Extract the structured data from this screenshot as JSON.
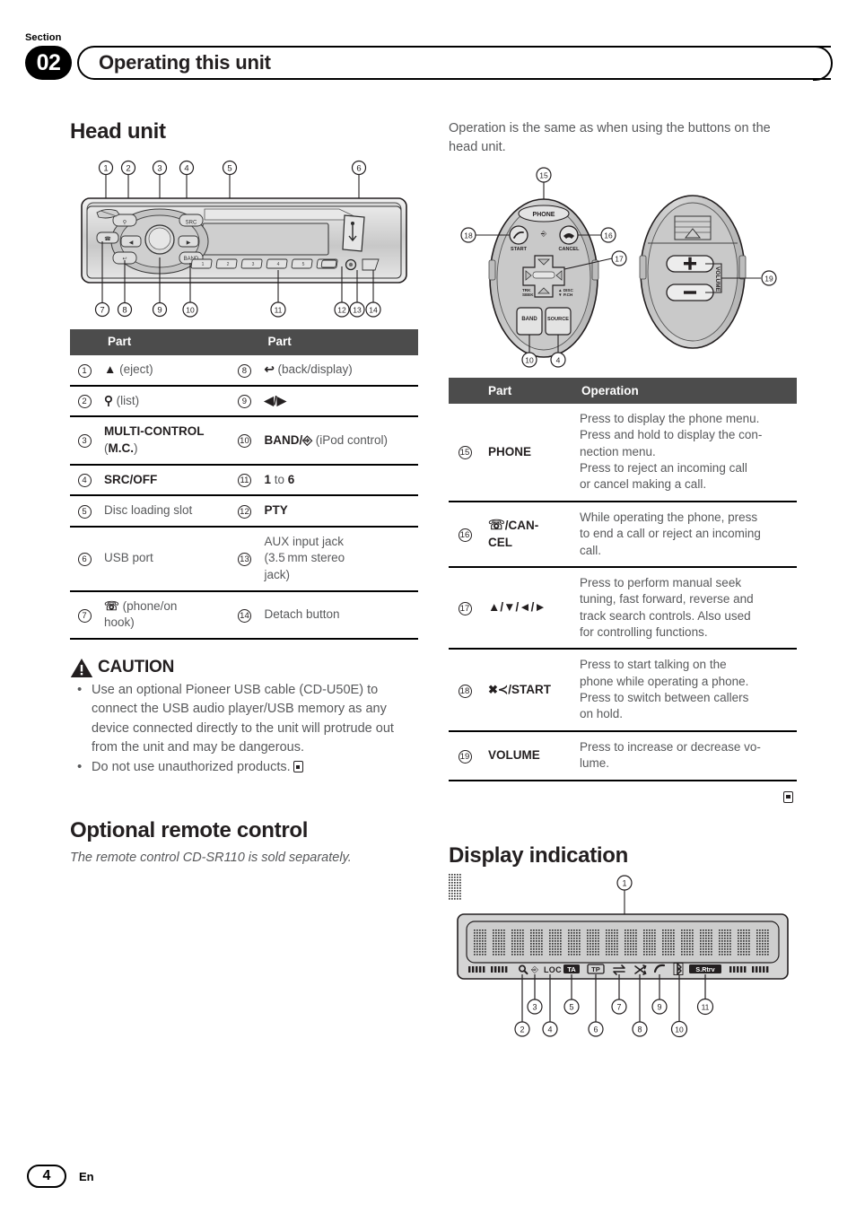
{
  "header": {
    "section_label": "Section",
    "section_number": "02",
    "title": "Operating this unit"
  },
  "left_column": {
    "heading": "Head unit",
    "parts_table": {
      "col1_header": "Part",
      "col2_header": "Part",
      "rows": [
        {
          "n1": "1",
          "p1": "▲ (eject)",
          "n2": "8",
          "p2": "↩ (back/display)"
        },
        {
          "n1": "2",
          "p1": "⌕ (list)",
          "n2": "9",
          "p2": "◄/►"
        },
        {
          "n1": "3",
          "p1": "MULTI-CONTROL (M.C.)",
          "n2": "10",
          "p2": "BAND/↵ (iPod control)"
        },
        {
          "n1": "4",
          "p1": "SRC/OFF",
          "n2": "11",
          "p2": "1 to 6"
        },
        {
          "n1": "5",
          "p1": "Disc loading slot",
          "n2": "12",
          "p2": "PTY"
        },
        {
          "n1": "6",
          "p1": "USB port",
          "n2": "13",
          "p2": "AUX input jack (3.5 mm stereo jack)"
        },
        {
          "n1": "7",
          "p1": "☎ (phone/on hook)",
          "n2": "14",
          "p2": "Detach button"
        }
      ]
    },
    "caution": {
      "title": "CAUTION",
      "bullets": [
        "Use an optional Pioneer USB cable (CD-U50E) to connect the USB audio player/USB memory as any device connected directly to the unit will protrude out from the unit and may be dangerous.",
        "Do not use unauthorized products."
      ]
    },
    "remote_heading": "Optional remote control",
    "remote_note": "The remote control CD-SR110 is sold separately."
  },
  "right_column": {
    "intro": "Operation is the same as when using the buttons on the head unit.",
    "ops_table": {
      "col_num_header": "",
      "col_part_header": "Part",
      "col_op_header": "Operation",
      "rows": [
        {
          "n": "15",
          "part": "PHONE",
          "op": "Press to display the phone menu. Press and hold to display the connection menu.\nPress to reject an incoming call or cancel making a call."
        },
        {
          "n": "16",
          "part": "☎/CANCEL",
          "op": "While operating the phone, press to end a call or reject an incoming call."
        },
        {
          "n": "17",
          "part": "▲/▼/◄/►",
          "op": "Press to perform manual seek tuning, fast forward, reverse and track search controls. Also used for controlling functions."
        },
        {
          "n": "18",
          "part": "✆/START",
          "op": "Press to start talking on the phone while operating a phone. Press to switch between callers on hold."
        },
        {
          "n": "19",
          "part": "VOLUME",
          "op": "Press to increase or decrease volume."
        }
      ]
    },
    "display_heading": "Display indication"
  },
  "figures": {
    "head_unit": {
      "callouts_top": [
        "1",
        "2",
        "3",
        "4",
        "5",
        "6"
      ],
      "callouts_bottom": [
        "7",
        "8",
        "9",
        "10",
        "11",
        "12",
        "13",
        "14"
      ],
      "preset_buttons": [
        "1",
        "2",
        "3",
        "4",
        "5",
        "6"
      ]
    },
    "remote_front": {
      "callouts": [
        "15",
        "18",
        "16",
        "17",
        "10",
        "4"
      ],
      "button_labels": [
        "PHONE",
        "START",
        "CANCEL",
        "TRK SEEK",
        "DISC P.CH",
        "BAND",
        "SOURCE"
      ]
    },
    "remote_back": {
      "callout": "19",
      "label": "VOLUME",
      "plus": "+",
      "minus": "−"
    },
    "display_panel": {
      "callout_top": "1",
      "callouts_row_upper": [
        "3",
        "5",
        "7",
        "9",
        "11"
      ],
      "callouts_row_lower": [
        "2",
        "4",
        "6",
        "8",
        "10"
      ],
      "indicators": [
        "loc-icon",
        "search-icon",
        "ipod-icon",
        "LOC",
        "TA",
        "TP",
        "repeat-icon",
        "shuffle-icon",
        "phone-icon",
        "bluetooth-icon",
        "S.Rtrv"
      ]
    }
  },
  "footer": {
    "page": "4",
    "language": "En"
  },
  "colors": {
    "table_header_bg": "#4c4c4c",
    "body_text": "#58595b",
    "heading": "#231f20",
    "rule": "#000000"
  }
}
